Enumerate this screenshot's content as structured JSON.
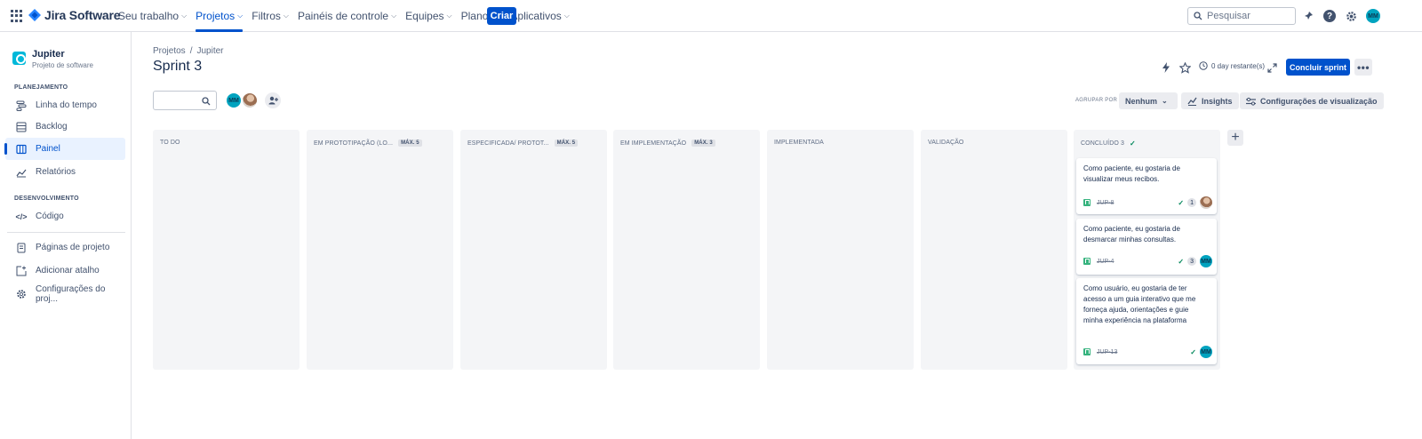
{
  "topnav": {
    "product": "Jira Software",
    "items": [
      {
        "label": "Seu trabalho",
        "active": false
      },
      {
        "label": "Projetos",
        "active": true
      },
      {
        "label": "Filtros",
        "active": false
      },
      {
        "label": "Painéis de controle",
        "active": false
      },
      {
        "label": "Equipes",
        "active": false
      },
      {
        "label": "Planos",
        "active": false
      },
      {
        "label": "Aplicativos",
        "active": false
      }
    ],
    "create_label": "Criar",
    "search_placeholder": "Pesquisar",
    "user_initials": "MM"
  },
  "sidebar": {
    "project_name": "Jupiter",
    "project_type": "Projeto de software",
    "planning_header": "PLANEJAMENTO",
    "planning_items": [
      "Linha do tempo",
      "Backlog",
      "Painel",
      "Relatórios"
    ],
    "dev_header": "DESENVOLVIMENTO",
    "dev_items": [
      "Código"
    ],
    "other_items": [
      "Páginas de projeto",
      "Adicionar atalho",
      "Configurações do proj..."
    ],
    "active_item": "Painel"
  },
  "header": {
    "breadcrumb": [
      "Projetos",
      "Jupiter"
    ],
    "breadcrumb_sep": "/",
    "title": "Sprint 3",
    "remaining": "0 day restante(s)",
    "complete_label": "Concluir sprint",
    "more_label": "•••"
  },
  "toolbar": {
    "avatar_initials": "MM",
    "group_by_label": "AGRUPAR POR",
    "group_by_value": "Nenhum",
    "insights_label": "Insights",
    "view_settings_label": "Configurações de visualização"
  },
  "board": {
    "columns": [
      {
        "title": "TO DO",
        "limit": ""
      },
      {
        "title": "EM PROTOTIPAÇÃO (LO...",
        "limit": "MÁX. 5"
      },
      {
        "title": "ESPECIFICADA/ PROTOT...",
        "limit": "MÁX. 5"
      },
      {
        "title": "EM IMPLEMENTAÇÃO",
        "limit": "MÁX. 3"
      },
      {
        "title": "IMPLEMENTADA",
        "limit": ""
      },
      {
        "title": "VALIDAÇÃO",
        "limit": ""
      },
      {
        "title": "CONCLUÍDO 3",
        "limit": "",
        "done_check": "✓"
      }
    ],
    "cards": [
      {
        "text": "Como paciente, eu gostaria de visualizar meus recibos.",
        "key": "JUP-8",
        "estimate": "1",
        "assignee": "photo"
      },
      {
        "text": "Como paciente, eu gostaria de desmarcar minhas consultas.",
        "key": "JUP-4",
        "estimate": "3",
        "assignee": "MM"
      },
      {
        "text": "Como usuário, eu gostaria de ter acesso a um guia interativo que me forneça ajuda, orientações e guie minha experiência na plataforma",
        "key": "JUP-13",
        "estimate": "",
        "assignee": "MM"
      }
    ]
  },
  "colors": {
    "primary": "#0052cc",
    "avatar": "#00a3bf",
    "story": "#36b37e",
    "done": "#00875a"
  }
}
